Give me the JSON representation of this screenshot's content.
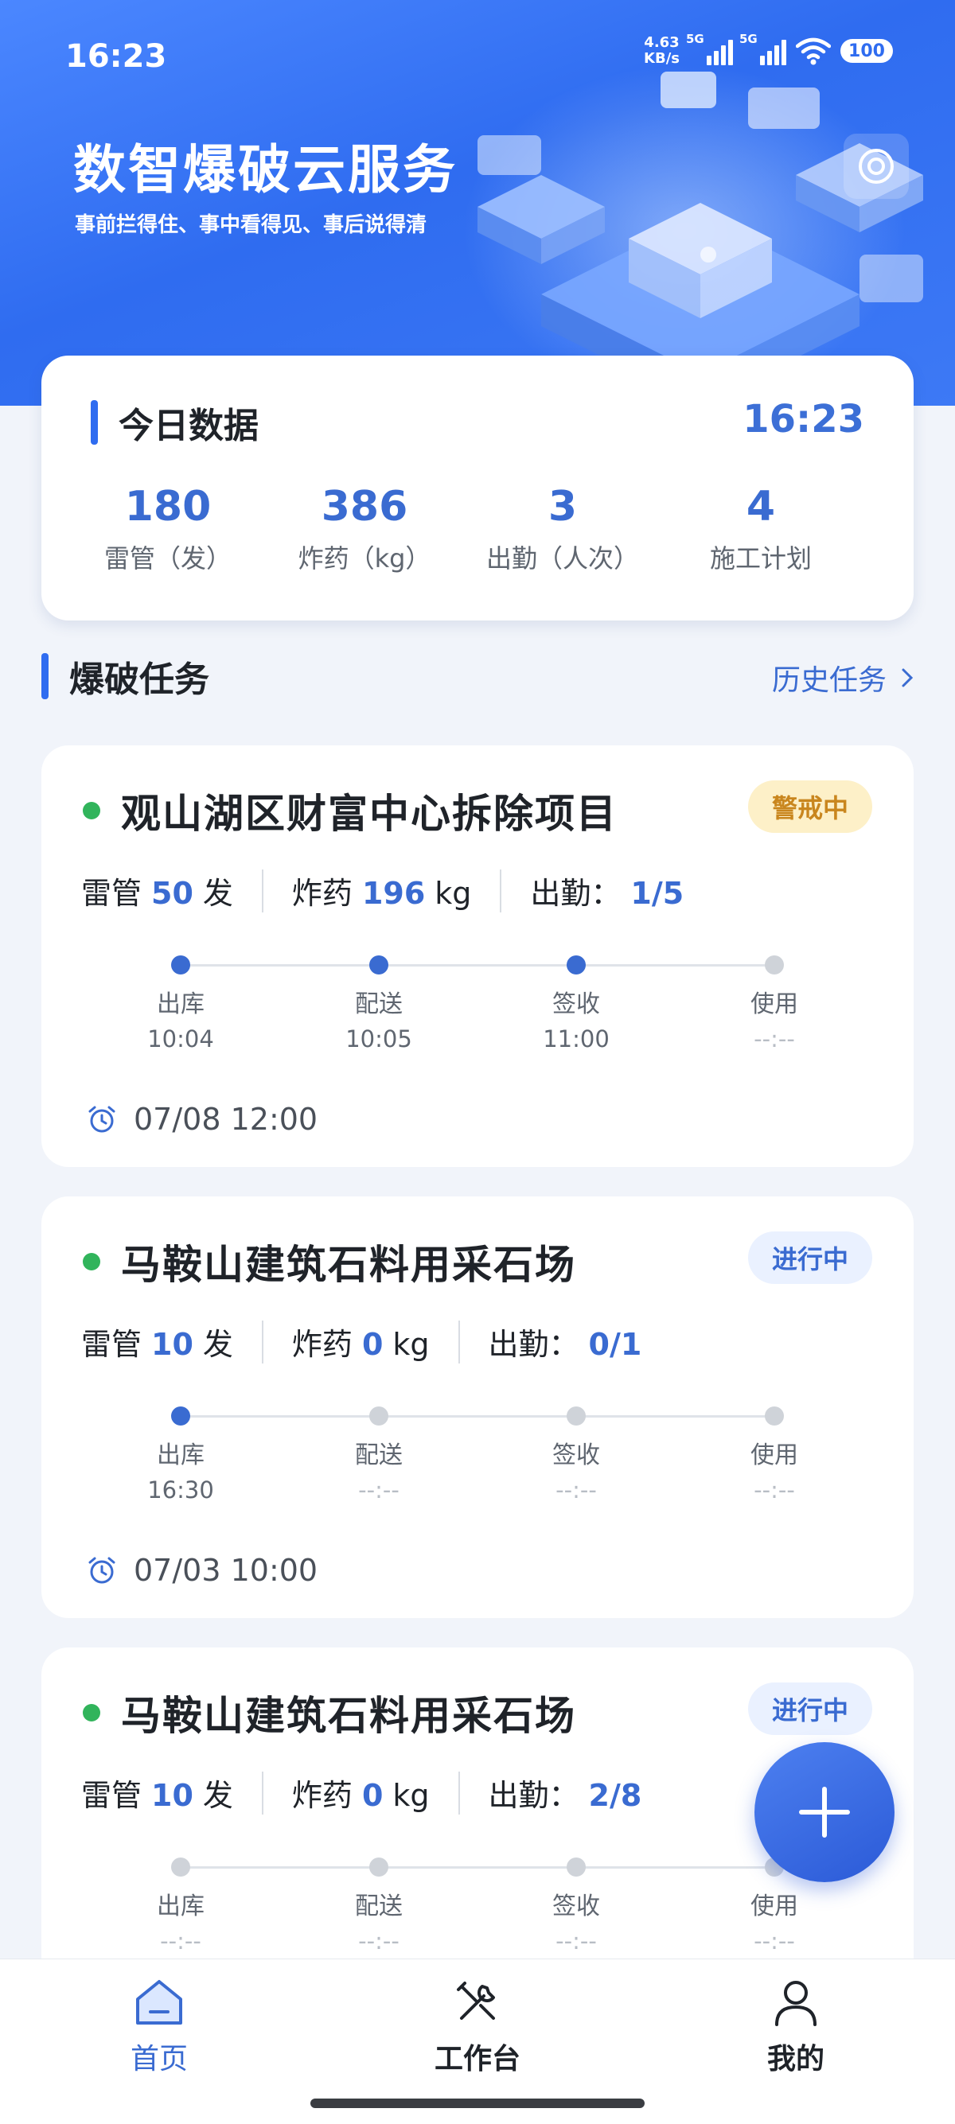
{
  "status_bar": {
    "time": "16:23",
    "net_speed_value": "4.63",
    "net_speed_unit": "KB/s",
    "signal_1_label": "5G",
    "signal_2_label": "5G",
    "battery": "100"
  },
  "hero": {
    "title": "数智爆破云服务",
    "subtitle": "事前拦得住、事中看得见、事后说得清"
  },
  "today": {
    "title": "今日数据",
    "time": "16:23",
    "stats": [
      {
        "value": "180",
        "label": "雷管（发）"
      },
      {
        "value": "386",
        "label": "炸药（kg）"
      },
      {
        "value": "3",
        "label": "出勤（人次）"
      },
      {
        "value": "4",
        "label": "施工计划"
      }
    ]
  },
  "tasks_section": {
    "title": "爆破任务",
    "history_link": "历史任务"
  },
  "labels": {
    "detonator": "雷管",
    "detonator_unit": "发",
    "explosive": "炸药",
    "explosive_unit": "kg",
    "attendance": "出勤："
  },
  "tasks": [
    {
      "name": "观山湖区财富中心拆除项目",
      "status": "警戒中",
      "detonators": "50",
      "explosives": "196",
      "attendance": "1/5",
      "steps": [
        {
          "label": "出库",
          "time": "10:04",
          "done": true
        },
        {
          "label": "配送",
          "time": "10:05",
          "done": true
        },
        {
          "label": "签收",
          "time": "11:00",
          "done": true
        },
        {
          "label": "使用",
          "time": "--:--",
          "done": false
        }
      ],
      "deadline": "07/08 12:00"
    },
    {
      "name": "马鞍山建筑石料用采石场",
      "status": "进行中",
      "detonators": "10",
      "explosives": "0",
      "attendance": "0/1",
      "steps": [
        {
          "label": "出库",
          "time": "16:30",
          "done": true
        },
        {
          "label": "配送",
          "time": "--:--",
          "done": false
        },
        {
          "label": "签收",
          "time": "--:--",
          "done": false
        },
        {
          "label": "使用",
          "time": "--:--",
          "done": false
        }
      ],
      "deadline": "07/03 10:00"
    },
    {
      "name": "马鞍山建筑石料用采石场",
      "status": "进行中",
      "detonators": "10",
      "explosives": "0",
      "attendance": "2/8",
      "steps": [
        {
          "label": "出库",
          "time": "--:--",
          "done": false
        },
        {
          "label": "配送",
          "time": "--:--",
          "done": false
        },
        {
          "label": "签收",
          "time": "--:--",
          "done": false
        },
        {
          "label": "使用",
          "time": "--:--",
          "done": false
        }
      ],
      "deadline": ""
    }
  ],
  "tabbar": {
    "items": [
      {
        "label": "首页",
        "icon": "home-icon",
        "active": true
      },
      {
        "label": "工作台",
        "icon": "tools-icon",
        "active": false
      },
      {
        "label": "我的",
        "icon": "user-icon",
        "active": false
      }
    ]
  },
  "colors": {
    "accent": "#3a6bd1",
    "hero_blue": "#2f6cf0",
    "status_green": "#31b45b",
    "warn_bg": "#fdf0c8",
    "warn_text": "#c9861e"
  }
}
